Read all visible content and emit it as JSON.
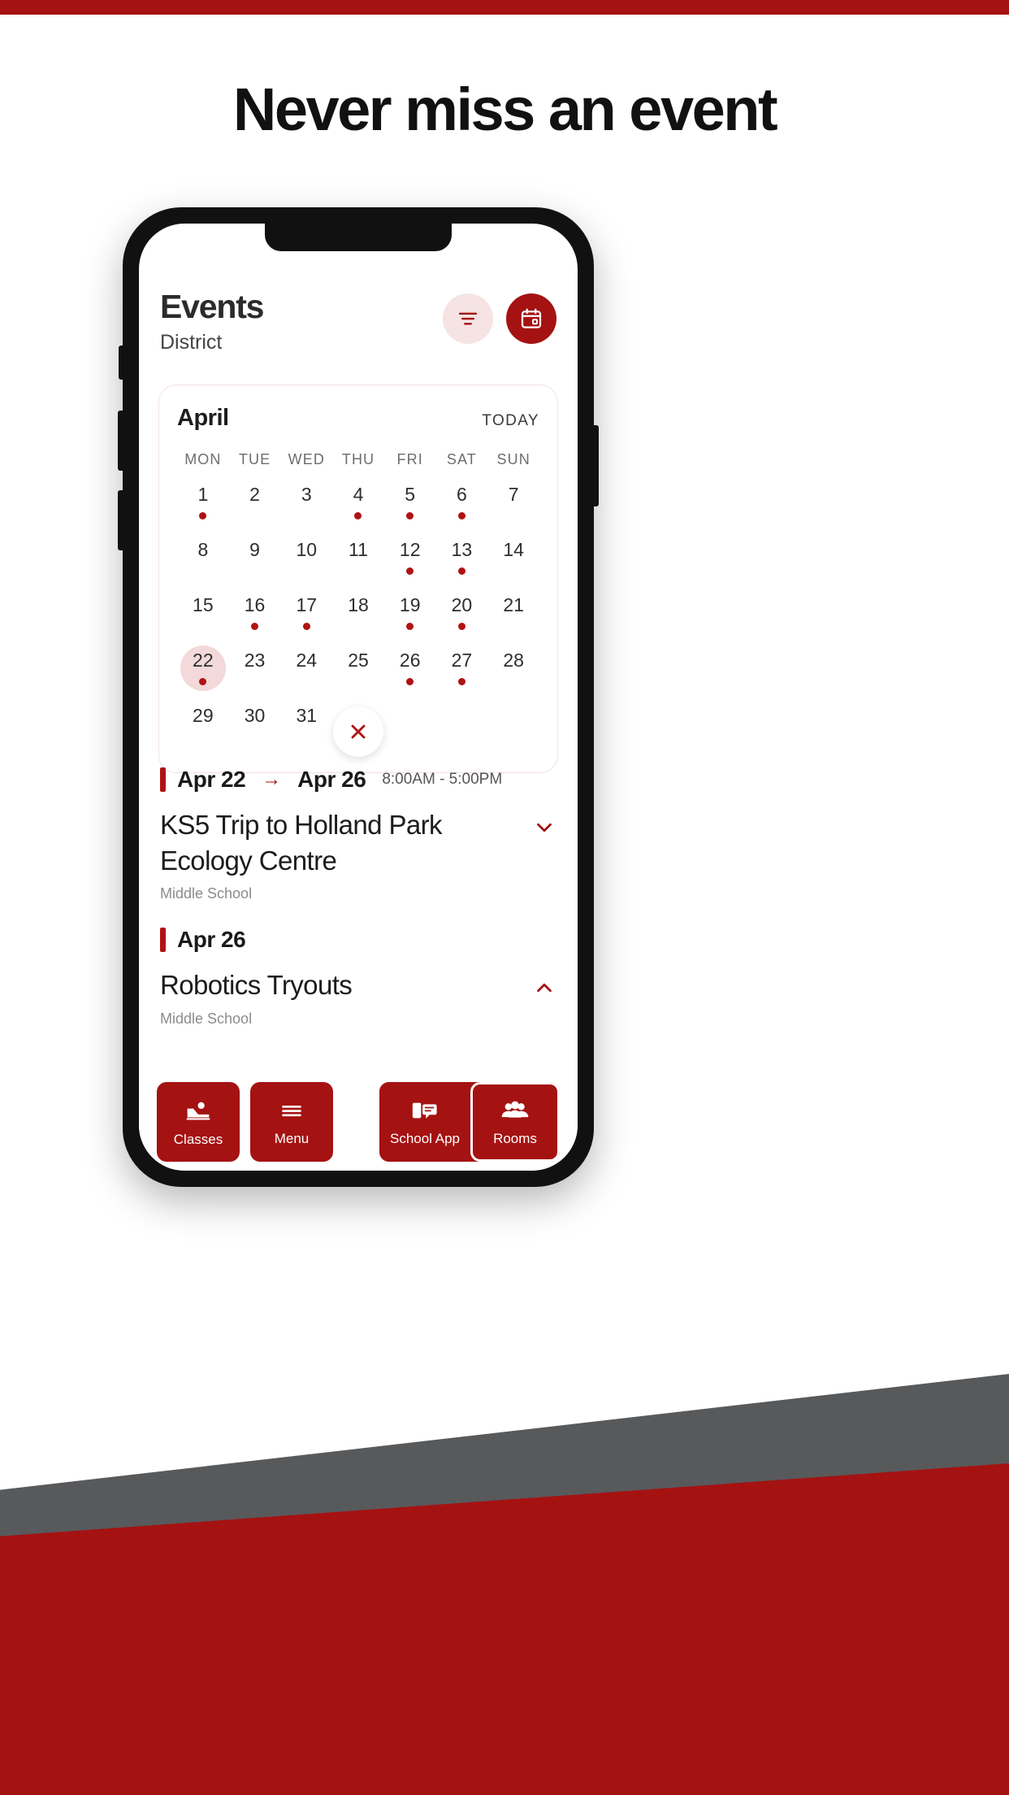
{
  "page": {
    "headline": "Never miss an event",
    "accent_red": "#A51212",
    "dark_gray": "#58595B"
  },
  "app": {
    "title": "Events",
    "subtitle": "District",
    "filter_icon": "filter-icon",
    "calendar_icon": "calendar-icon"
  },
  "calendar": {
    "month": "April",
    "today_label": "TODAY",
    "weekdays": [
      "MON",
      "TUE",
      "WED",
      "THU",
      "FRI",
      "SAT",
      "SUN"
    ],
    "lead_blanks": 0,
    "selected_day": 22,
    "days_with_events": [
      1,
      4,
      5,
      6,
      12,
      13,
      16,
      17,
      19,
      20,
      22,
      26,
      27
    ],
    "days": [
      1,
      2,
      3,
      4,
      5,
      6,
      7,
      8,
      9,
      10,
      11,
      12,
      13,
      14,
      15,
      16,
      17,
      18,
      19,
      20,
      21,
      22,
      23,
      24,
      25,
      26,
      27,
      28,
      29,
      30,
      31
    ],
    "close_icon": "close-icon"
  },
  "events": [
    {
      "date_start": "Apr 22",
      "arrow": "→",
      "date_end": "Apr 26",
      "time": "8:00AM  -  5:00PM",
      "title": "KS5 Trip to Holland Park Ecology Centre",
      "subtitle": "Middle School",
      "chevron": "chevron-down-icon",
      "chevron_glyph": "⌄"
    },
    {
      "date_start": "Apr 26",
      "arrow": "",
      "date_end": "",
      "time": "",
      "title": "Robotics Tryouts",
      "subtitle": "Middle School",
      "chevron": "chevron-up-icon",
      "chevron_glyph": "⌃"
    }
  ],
  "bottom_nav": {
    "left": [
      {
        "label": "Classes",
        "icon": "classes-icon"
      },
      {
        "label": "Menu",
        "icon": "hamburger-icon"
      }
    ],
    "right": [
      {
        "label": "School App",
        "icon": "school-app-icon",
        "active": false
      },
      {
        "label": "Rooms",
        "icon": "rooms-icon",
        "active": true
      }
    ]
  }
}
